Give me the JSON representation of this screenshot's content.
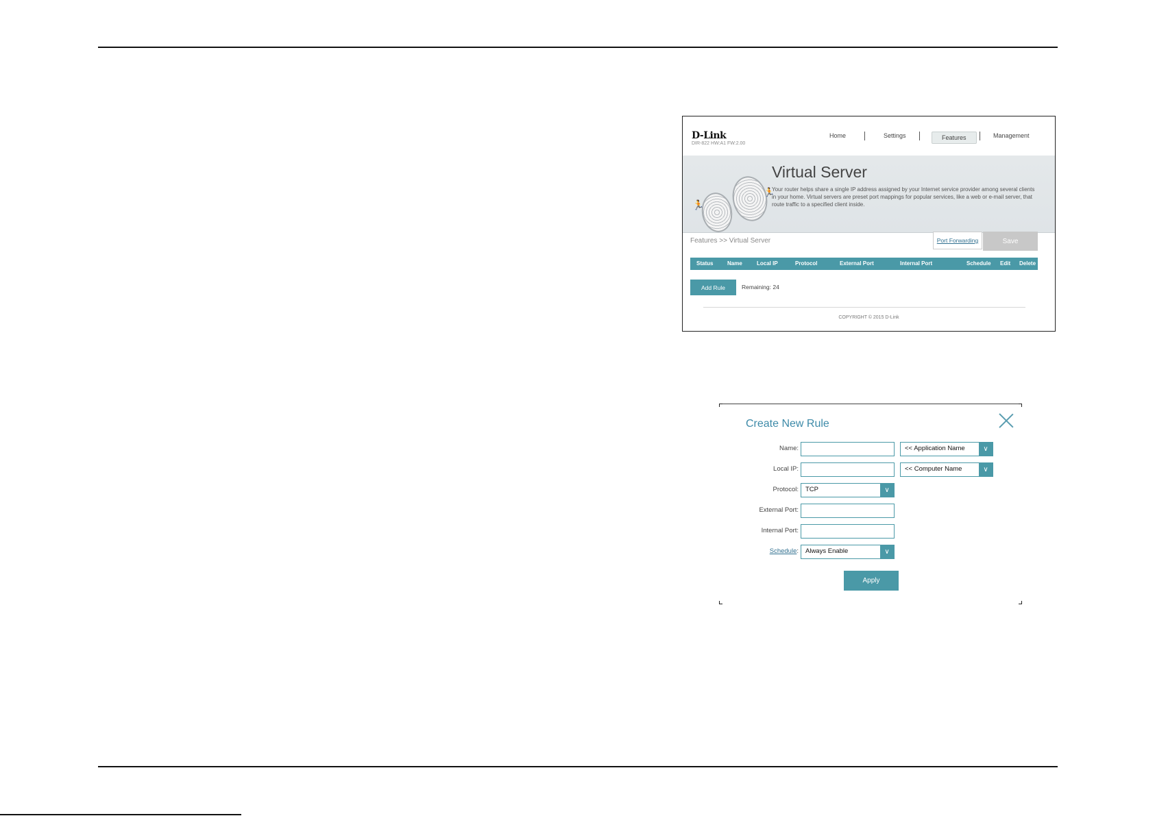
{
  "router_ui": {
    "brand": "D-Link",
    "model": "DIR-822 HW:A1 FW:2.00",
    "nav": [
      "Home",
      "Settings",
      "Features",
      "Management"
    ],
    "active_nav": "Features",
    "page_title": "Virtual Server",
    "description": "Your router helps share a single IP address assigned by your Internet service provider among several clients in your home. Virtual servers are preset port mappings for popular services, like a web or e-mail server, that route traffic to a specified client inside.",
    "breadcrumb": "Features >> Virtual Server",
    "port_forwarding_link": "Port Forwarding",
    "save_label": "Save",
    "table_headers": [
      "Status",
      "Name",
      "Local IP",
      "Protocol",
      "External Port",
      "Internal Port",
      "Schedule",
      "Edit",
      "Delete"
    ],
    "add_rule_label": "Add Rule",
    "remaining": "Remaining: 24",
    "copyright": "COPYRIGHT © 2015 D-Link"
  },
  "dialog": {
    "title": "Create New Rule",
    "name_label": "Name:",
    "name_value": "",
    "application_select": "<< Application Name",
    "local_ip_label": "Local IP:",
    "local_ip_value": "",
    "computer_select": "<< Computer Name",
    "protocol_label": "Protocol:",
    "protocol_value": "TCP",
    "external_port_label": "External Port:",
    "external_port_value": "",
    "internal_port_label": "Internal Port:",
    "internal_port_value": "",
    "schedule_label": "Schedule",
    "schedule_suffix": ":",
    "schedule_value": "Always Enable",
    "apply_label": "Apply"
  },
  "colors": {
    "accent": "#4a99a7",
    "link": "#2f6f8f",
    "title": "#3d8aa8"
  }
}
